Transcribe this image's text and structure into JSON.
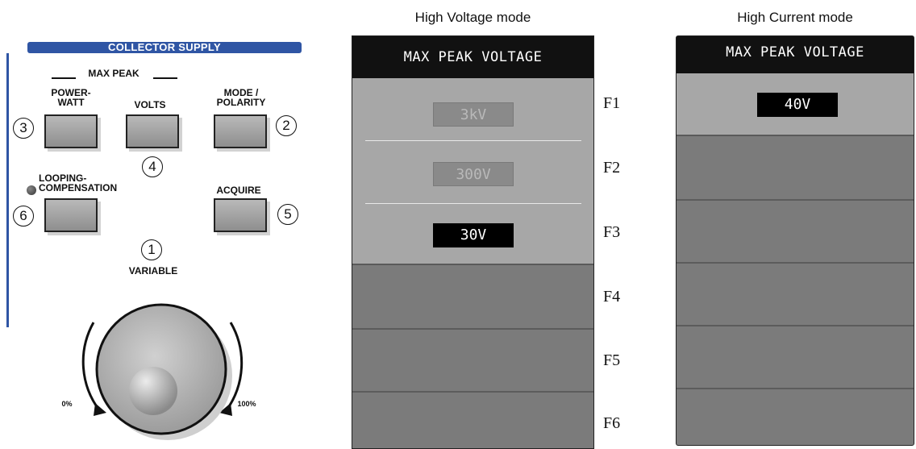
{
  "panel": {
    "header": "COLLECTOR SUPPLY",
    "max_peak": "MAX PEAK",
    "power_watt_label": "POWER-\nWATT",
    "volts_label": "VOLTS",
    "mode_polarity_label": "MODE /\nPOLARITY",
    "looping_label": "LOOPING-\nCOMPENSATION",
    "acquire_label": "ACQUIRE",
    "variable_label": "VARIABLE",
    "knob_min": "0%",
    "knob_max": "100%",
    "callouts": {
      "variable": "1",
      "mode_polarity": "2",
      "power_watt": "3",
      "volts": "4",
      "acquire": "5",
      "looping": "6"
    }
  },
  "high_voltage": {
    "title": "High Voltage mode",
    "header": "MAX PEAK VOLTAGE",
    "options": [
      "3kV",
      "300V",
      "30V"
    ],
    "selected": "30V"
  },
  "high_current": {
    "title": "High Current mode",
    "header": "MAX PEAK VOLTAGE",
    "options": [
      "40V"
    ],
    "selected": "40V"
  },
  "fkeys": [
    "F1",
    "F2",
    "F3",
    "F4",
    "F5",
    "F6"
  ],
  "colors": {
    "panel_blue": "#2f55a4",
    "menu_header": "#111111",
    "menu_body": "#7b7b7b",
    "menu_active_block": "#a7a7a7"
  }
}
